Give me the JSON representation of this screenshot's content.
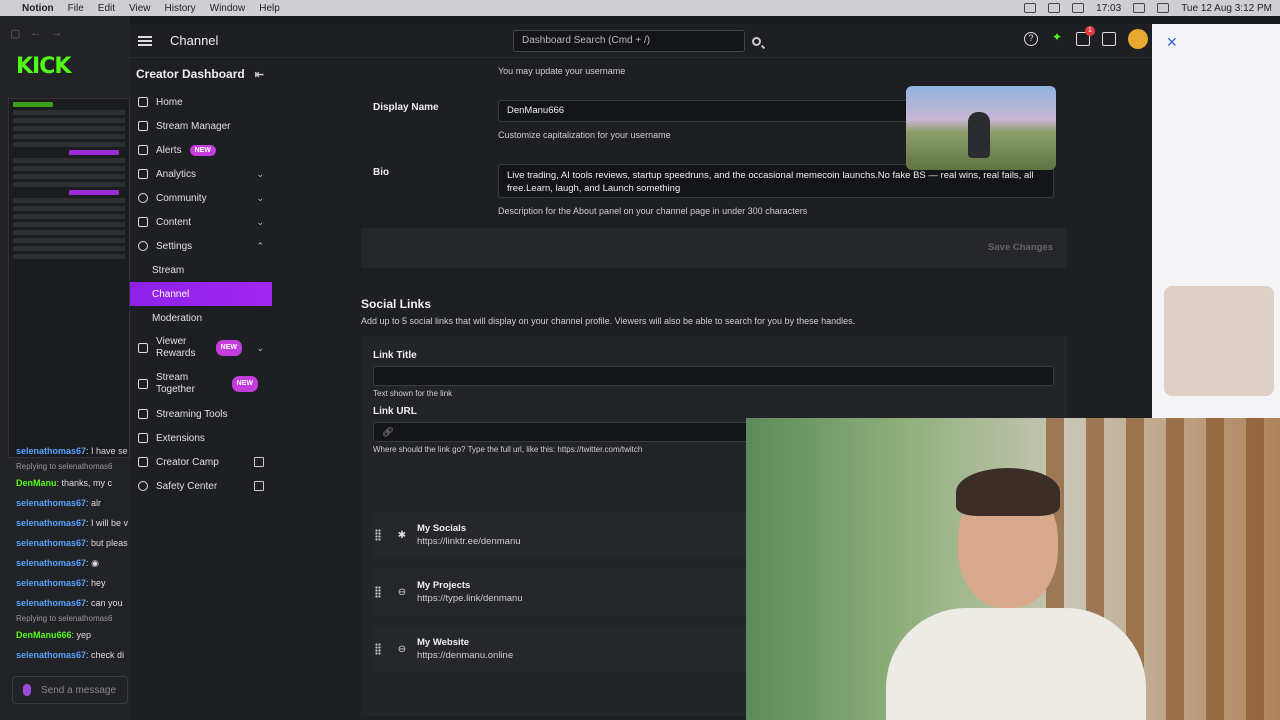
{
  "menubar": {
    "app": "Notion",
    "items": [
      "File",
      "Edit",
      "View",
      "History",
      "Window",
      "Help"
    ],
    "clock": "17:03",
    "date": "Tue 12 Aug  3:12 PM"
  },
  "share": {
    "chat": [
      {
        "user": "selenathomas67",
        "text": ": I have se"
      },
      {
        "reply": "Replying to selenathomas6"
      },
      {
        "user": "DenManu",
        "text": ": thanks, my c",
        "green": true
      },
      {
        "user": "selenathomas67",
        "text": ": alr"
      },
      {
        "user": "selenathomas67",
        "text": ": I will be v"
      },
      {
        "user": "selenathomas67",
        "text": ": but pleas"
      },
      {
        "user": "selenathomas67",
        "text": ":"
      },
      {
        "user": "selenathomas67",
        "text": ": hey"
      },
      {
        "user": "selenathomas67",
        "text": ": can you"
      },
      {
        "reply": "Replying to selenathomas6"
      },
      {
        "user": "DenManu666",
        "text": ": yep",
        "green": true
      },
      {
        "user": "selenathomas67",
        "text": ": check di"
      }
    ],
    "send_placeholder": "Send a message"
  },
  "topbar": {
    "title": "Channel",
    "search_placeholder": "Dashboard Search (Cmd + /)",
    "notif_count": "1"
  },
  "sidebar": {
    "heading": "Creator Dashboard",
    "items": [
      {
        "label": "Home"
      },
      {
        "label": "Stream Manager"
      },
      {
        "label": "Alerts",
        "badge": "NEW"
      },
      {
        "label": "Analytics"
      },
      {
        "label": "Community"
      },
      {
        "label": "Content"
      },
      {
        "label": "Settings"
      },
      {
        "label": "Stream"
      },
      {
        "label": "Channel"
      },
      {
        "label": "Moderation"
      },
      {
        "label": "Viewer Rewards",
        "badge": "NEW"
      },
      {
        "label": "Stream Together",
        "badge": "NEW"
      },
      {
        "label": "Streaming Tools"
      },
      {
        "label": "Extensions"
      },
      {
        "label": "Creator Camp"
      },
      {
        "label": "Safety Center"
      }
    ]
  },
  "form": {
    "username_hint": "You may update your username",
    "display_name_label": "Display Name",
    "display_name_value": "DenManu666",
    "display_name_hint": "Customize capitalization for your username",
    "bio_label": "Bio",
    "bio_value": "Live trading, AI tools reviews, startup speedruns, and the occasional memecoin launchs.No fake BS — real wins, real fails, all free.Learn, laugh, and Launch something",
    "bio_hint": "Description for the About panel on your channel page in under 300 characters",
    "save_label": "Save Changes"
  },
  "social": {
    "heading": "Social Links",
    "description": "Add up to 5 social links that will display on your channel profile. Viewers will also be able to search for you by these handles.",
    "link_title_label": "Link Title",
    "link_title_hint": "Text shown for the link",
    "link_url_label": "Link URL",
    "link_url_hint": "Where should the link go? Type the full url, like this: https://twitter.com/twitch",
    "links": [
      {
        "title": "My Socials",
        "url": "https://linktr.ee/denmanu",
        "icon": "asterisk-icon"
      },
      {
        "title": "My Projects",
        "url": "https://type.link/denmanu",
        "icon": "link-icon"
      },
      {
        "title": "My Website",
        "url": "https://denmanu.online",
        "icon": "link-icon"
      }
    ]
  },
  "colors": {
    "accent": "#8d22e8",
    "brand": "#53fc18"
  }
}
